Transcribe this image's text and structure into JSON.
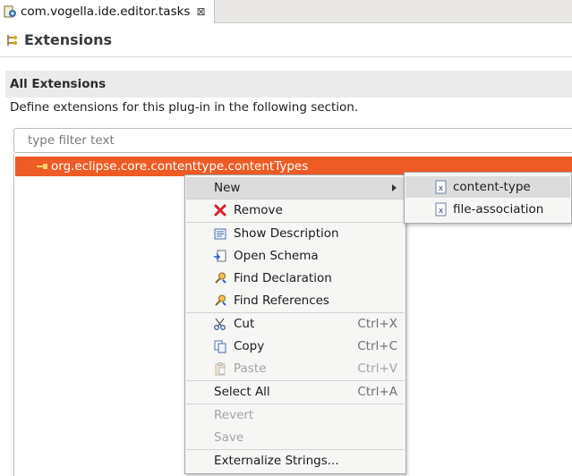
{
  "tab": {
    "title": "com.vogella.ide.editor.tasks",
    "close_glyph": "⊠",
    "icon": "plugin-manifest-icon"
  },
  "header": {
    "title": "Extensions",
    "icon": "extensions-icon"
  },
  "section": {
    "title": "All Extensions",
    "description": "Define extensions for this plug-in in the following section."
  },
  "filter": {
    "placeholder": "type filter text",
    "value": ""
  },
  "tree": {
    "items": [
      {
        "label": "org.eclipse.core.contenttype.contentTypes",
        "selected": true,
        "icon": "extension-point-icon"
      }
    ]
  },
  "context_menu": {
    "items": [
      {
        "label": "New",
        "shortcut": "",
        "icon": "",
        "has_submenu": true,
        "enabled": true
      },
      {
        "label": "Remove",
        "shortcut": "",
        "icon": "remove-icon",
        "enabled": true
      },
      {
        "label": "Show Description",
        "shortcut": "",
        "icon": "description-icon",
        "enabled": true
      },
      {
        "label": "Open Schema",
        "shortcut": "",
        "icon": "schema-icon",
        "enabled": true
      },
      {
        "label": "Find Declaration",
        "shortcut": "",
        "icon": "find-icon",
        "enabled": true
      },
      {
        "label": "Find References",
        "shortcut": "",
        "icon": "find-icon",
        "enabled": true
      },
      {
        "label": "Cut",
        "shortcut": "Ctrl+X",
        "icon": "scissors-icon",
        "enabled": true
      },
      {
        "label": "Copy",
        "shortcut": "Ctrl+C",
        "icon": "copy-icon",
        "enabled": true
      },
      {
        "label": "Paste",
        "shortcut": "Ctrl+V",
        "icon": "paste-icon",
        "enabled": false
      },
      {
        "label": "Select All",
        "shortcut": "Ctrl+A",
        "icon": "",
        "enabled": true
      },
      {
        "label": "Revert",
        "shortcut": "",
        "icon": "",
        "enabled": false
      },
      {
        "label": "Save",
        "shortcut": "",
        "icon": "",
        "enabled": false
      },
      {
        "label": "Externalize Strings...",
        "shortcut": "",
        "icon": "",
        "enabled": true
      }
    ]
  },
  "submenu": {
    "items": [
      {
        "label": "content-type",
        "icon": "xml-element-icon"
      },
      {
        "label": "file-association",
        "icon": "xml-element-icon"
      }
    ]
  },
  "colors": {
    "selection": "#ef5b25",
    "menu_bg": "#f6f6f5",
    "menu_highlight": "#dcdcdc",
    "disabled_text": "#a3a3a3"
  }
}
